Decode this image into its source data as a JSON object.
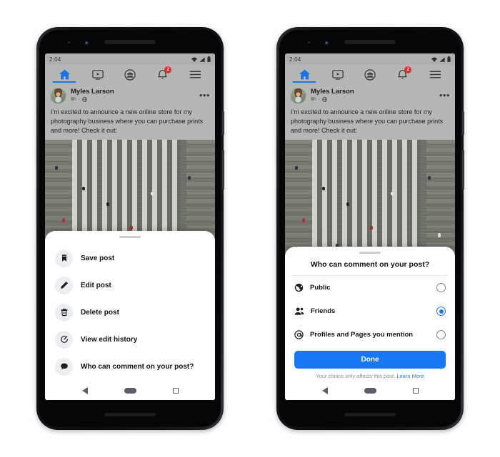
{
  "device": {
    "status_bar": {
      "time": "2:04",
      "icons": [
        "wifi-icon",
        "signal-icon",
        "battery-icon"
      ]
    },
    "android_nav": {
      "back": "back-triangle-icon",
      "home": "home-pill-icon",
      "recents": "recents-square-icon"
    }
  },
  "app": {
    "nav_tabs": [
      {
        "name": "home",
        "icon": "home-icon",
        "active": true,
        "badge": ""
      },
      {
        "name": "watch",
        "icon": "video-play-icon",
        "active": false,
        "badge": ""
      },
      {
        "name": "groups",
        "icon": "groups-icon",
        "active": false,
        "badge": ""
      },
      {
        "name": "notifications",
        "icon": "bell-icon",
        "active": false,
        "badge": "2"
      },
      {
        "name": "menu",
        "icon": "hamburger-icon",
        "active": false,
        "badge": ""
      }
    ],
    "post": {
      "author": "Myles Larson",
      "timestamp": "8h",
      "separator": "·",
      "audience_icon": "globe-icon",
      "more_options": "•••",
      "body": "I'm excited to announce a new online store for my photography business where you can purchase prints and more! Check it out:",
      "photo_alt": "aerial-crosswalk-photo"
    }
  },
  "left_phone": {
    "sheet": {
      "grabber": "drag-handle",
      "items": [
        {
          "icon": "bookmark-icon",
          "label": "Save post"
        },
        {
          "icon": "pencil-icon",
          "label": "Edit post"
        },
        {
          "icon": "trash-icon",
          "label": "Delete post"
        },
        {
          "icon": "edit-history-icon",
          "label": "View edit history"
        },
        {
          "icon": "speech-bubble-icon",
          "label": "Who can comment on your post?"
        }
      ]
    }
  },
  "right_phone": {
    "dialog": {
      "grabber": "drag-handle",
      "title": "Who can comment on your post?",
      "options": [
        {
          "icon": "globe-icon",
          "label": "Public",
          "selected": false
        },
        {
          "icon": "friends-icon",
          "label": "Friends",
          "selected": true
        },
        {
          "icon": "at-mention-icon",
          "label": "Profiles and Pages you mention",
          "selected": false
        }
      ],
      "primary_button": "Done",
      "footer_text": "Your choice only affects this post.",
      "footer_link": "Learn More"
    }
  },
  "colors": {
    "facebook_blue": "#1877f2",
    "link_blue": "#3578e5",
    "badge_red": "#e02c2c",
    "sheet_white": "#ffffff",
    "screen_grey": "#b6b6b6"
  }
}
